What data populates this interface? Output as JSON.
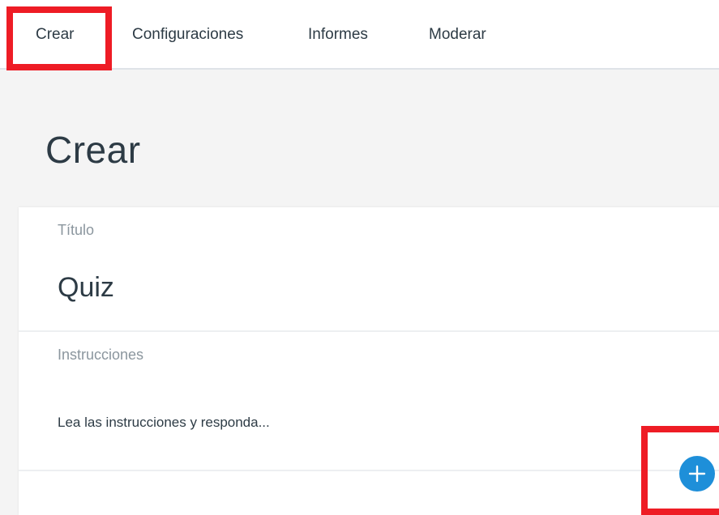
{
  "nav": {
    "tabs": [
      {
        "label": "Crear"
      },
      {
        "label": "Configuraciones"
      },
      {
        "label": "Informes"
      },
      {
        "label": "Moderar"
      }
    ]
  },
  "page": {
    "title": "Crear"
  },
  "form": {
    "title_label": "Título",
    "title_value": "Quiz",
    "instructions_label": "Instrucciones",
    "instructions_value": "Lea las instrucciones y responda..."
  },
  "colors": {
    "highlight": "#ee1c25",
    "accent": "#1e8fd9"
  },
  "icons": {
    "add": "plus-icon"
  }
}
